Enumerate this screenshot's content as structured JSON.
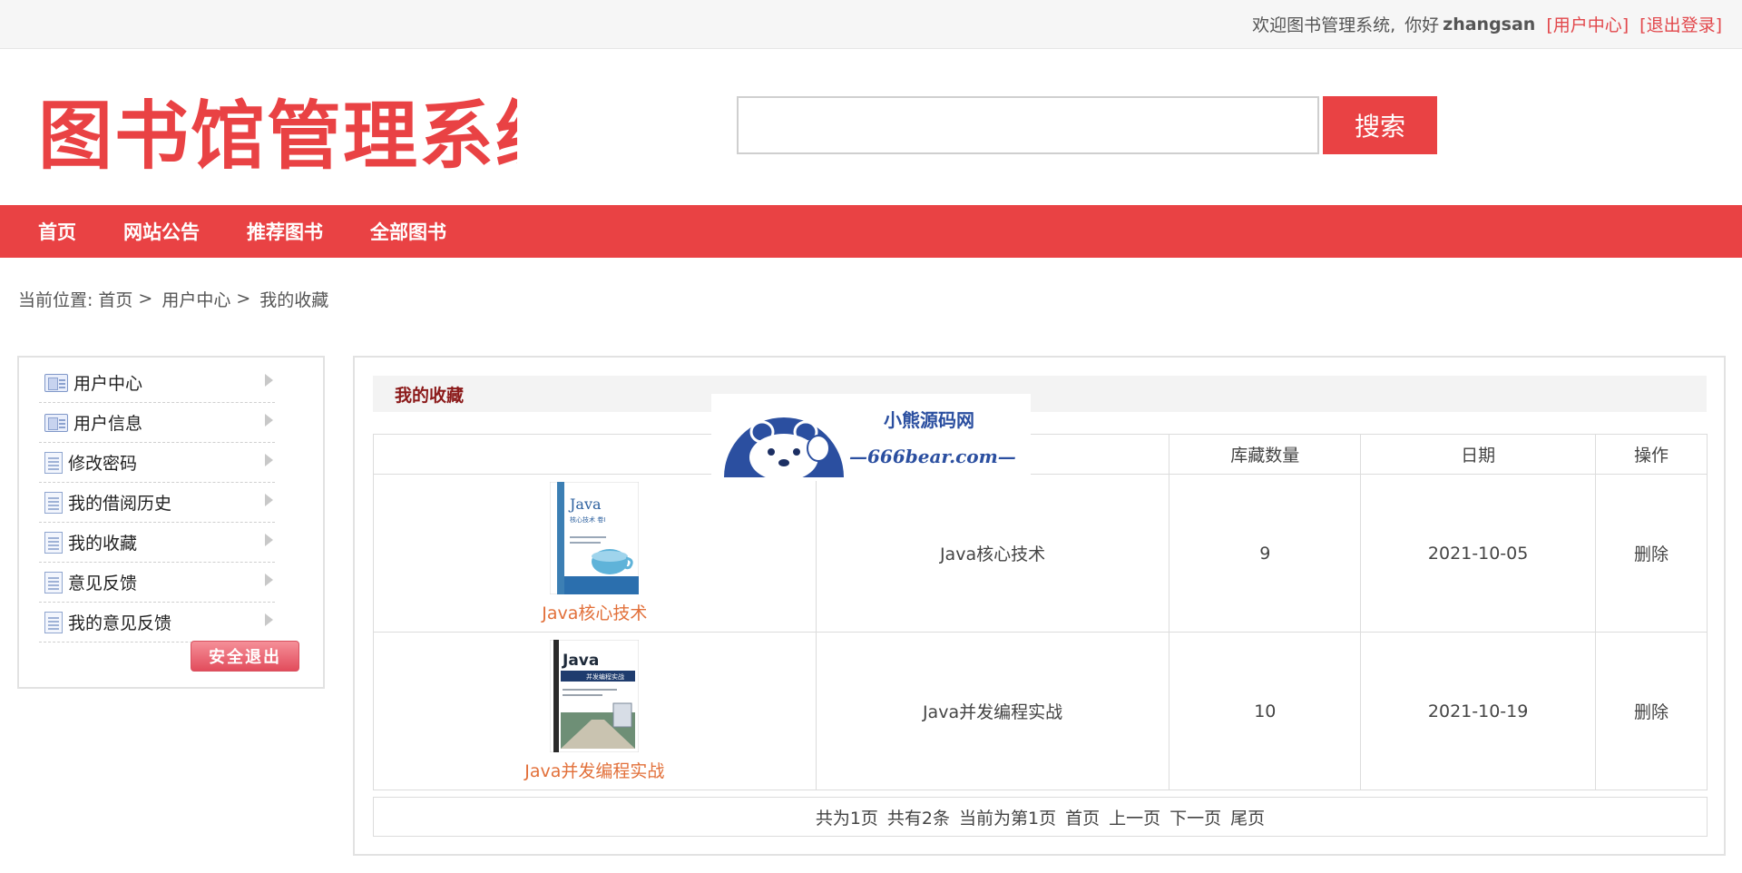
{
  "topbar": {
    "welcome": "欢迎图书管理系统,",
    "greeting": "你好",
    "username": "zhangsan",
    "user_center_link": "[用户中心]",
    "logout_link": "[退出登录]"
  },
  "header": {
    "logo_text": "图书馆管理系统",
    "search_placeholder": "",
    "search_button": "搜索",
    "brand_color": "#e94244"
  },
  "nav": {
    "items": [
      "首页",
      "网站公告",
      "推荐图书",
      "全部图书"
    ]
  },
  "breadcrumb": {
    "prefix": "当前位置:",
    "items": [
      "首页",
      "用户中心",
      "我的收藏"
    ],
    "separator": ">"
  },
  "sidebar": {
    "items": [
      {
        "label": "用户中心",
        "icon": "user-card-icon"
      },
      {
        "label": "用户信息",
        "icon": "user-card-icon"
      },
      {
        "label": "修改密码",
        "icon": "document-icon"
      },
      {
        "label": "我的借阅历史",
        "icon": "document-icon"
      },
      {
        "label": "我的收藏",
        "icon": "document-icon"
      },
      {
        "label": "意见反馈",
        "icon": "document-icon"
      },
      {
        "label": "我的意见反馈",
        "icon": "document-icon"
      }
    ],
    "logout_button": "安全退出"
  },
  "main": {
    "title": "我的收藏",
    "table": {
      "headers": [
        "",
        "",
        "库藏数量",
        "日期",
        "操作"
      ],
      "rows": [
        {
          "cover_link": "Java核心技术",
          "name": "Java核心技术",
          "stock": "9",
          "date": "2021-10-05",
          "action": "删除"
        },
        {
          "cover_link": "Java并发编程实战",
          "name": "Java并发编程实战",
          "stock": "10",
          "date": "2021-10-19",
          "action": "删除"
        }
      ]
    },
    "pager": {
      "total_pages": "共为1页",
      "total_items": "共有2条",
      "current": "当前为第1页",
      "first": "首页",
      "prev": "上一页",
      "next": "下一页",
      "last": "尾页"
    }
  },
  "watermark": {
    "title": "小熊源码网",
    "domain": "—666bear.com—"
  },
  "covers": {
    "cover1_title": "Java",
    "cover1_subtitle": "核心技术 卷Ⅰ",
    "cover2_title": "Java",
    "cover2_subtitle": "并发编程实战"
  }
}
